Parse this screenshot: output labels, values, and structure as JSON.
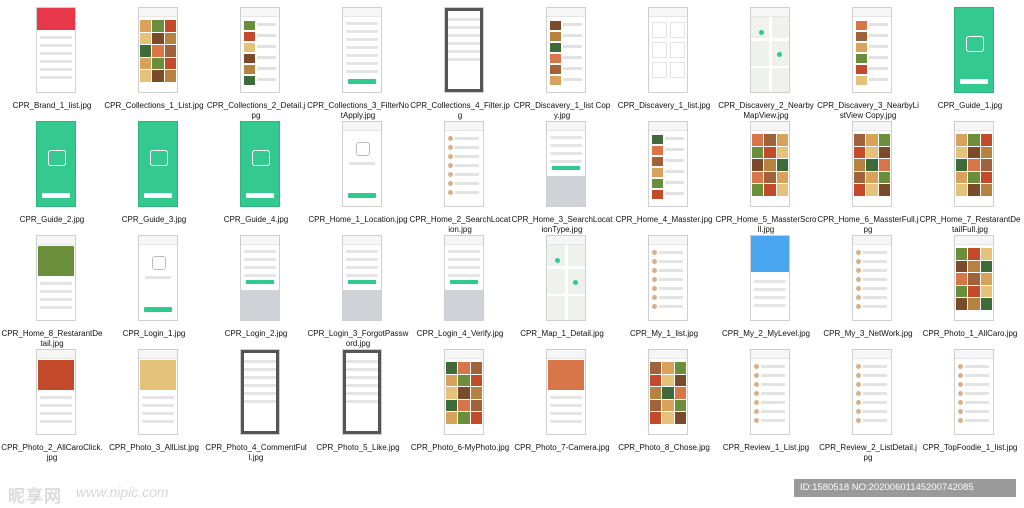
{
  "tiles": [
    {
      "label": "CPR_Brand_1_list.jpg",
      "style": "brand"
    },
    {
      "label": "CPR_Collections_1_List.jpg",
      "style": "photos"
    },
    {
      "label": "CPR_Collections_2_Detail.jpg",
      "style": "photolist"
    },
    {
      "label": "CPR_Collections_3_FilterNotApply.jpg",
      "style": "filter"
    },
    {
      "label": "CPR_Collections_4_Filter.jpg",
      "style": "dark"
    },
    {
      "label": "CPR_Discavery_1_list Copy.jpg",
      "style": "photolist"
    },
    {
      "label": "CPR_Discavery_1_list.jpg",
      "style": "cards"
    },
    {
      "label": "CPR_Discavery_2_NearbyMapView.jpg",
      "style": "map"
    },
    {
      "label": "CPR_Discavery_3_NearbyListView Copy.jpg",
      "style": "photolist"
    },
    {
      "label": "CPR_Guide_1.jpg",
      "style": "green"
    },
    {
      "label": "CPR_Guide_2.jpg",
      "style": "green"
    },
    {
      "label": "CPR_Guide_3.jpg",
      "style": "green"
    },
    {
      "label": "CPR_Guide_4.jpg",
      "style": "green"
    },
    {
      "label": "CPR_Home_1_Location.jpg",
      "style": "plain"
    },
    {
      "label": "CPR_Home_2_SearchLocation.jpg",
      "style": "list"
    },
    {
      "label": "CPR_Home_3_SearchLocationType.jpg",
      "style": "keyboard"
    },
    {
      "label": "CPR_Home_4_Masster.jpg",
      "style": "photolist"
    },
    {
      "label": "CPR_Home_5_MassterScroll.jpg",
      "style": "photos"
    },
    {
      "label": "CPR_Home_6_MassterFull.jpg",
      "style": "photos"
    },
    {
      "label": "CPR_Home_7_RestarantDetailFull.jpg",
      "style": "photos"
    },
    {
      "label": "CPR_Home_8_RestarantDetail.jpg",
      "style": "detail"
    },
    {
      "label": "CPR_Login_1.jpg",
      "style": "plain"
    },
    {
      "label": "CPR_Login_2.jpg",
      "style": "keyboard"
    },
    {
      "label": "CPR_Login_3_ForgotPassword.jpg",
      "style": "keyboard"
    },
    {
      "label": "CPR_Login_4_Verify.jpg",
      "style": "keyboard"
    },
    {
      "label": "CPR_Map_1_Detail.jpg",
      "style": "map"
    },
    {
      "label": "CPR_My_1_list.jpg",
      "style": "list"
    },
    {
      "label": "CPR_My_2_MyLevel.jpg",
      "style": "blue"
    },
    {
      "label": "CPR_My_3_NetWork.jpg",
      "style": "list"
    },
    {
      "label": "CPR_Photo_1_AllCaro.jpg",
      "style": "photos"
    },
    {
      "label": "CPR_Photo_2_AllCaroClick.jpg",
      "style": "detail"
    },
    {
      "label": "CPR_Photo_3_AllList.jpg",
      "style": "detail"
    },
    {
      "label": "CPR_Photo_4_CommentFull.jpg",
      "style": "dark"
    },
    {
      "label": "CPR_Photo_5_Like.jpg",
      "style": "dark"
    },
    {
      "label": "CPR_Photo_6-MyPhoto.jpg",
      "style": "photos"
    },
    {
      "label": "CPR_Photo_7-Camera.jpg",
      "style": "detail"
    },
    {
      "label": "CPR_Photo_8_Chose.jpg",
      "style": "photos"
    },
    {
      "label": "CPR_Review_1_List.jpg",
      "style": "list"
    },
    {
      "label": "CPR_Review_2_ListDetail.jpg",
      "style": "list"
    },
    {
      "label": "CPR_TopFoodie_1_list.jpg",
      "style": "list"
    }
  ],
  "watermark": {
    "logo": "昵享网",
    "url": "www.nipic.com"
  },
  "id_bar": {
    "text": "ID:1580518 NO:20200601145200742085"
  },
  "colors": {
    "accent_green": "#2fcb8e",
    "brand_red": "#e8364a",
    "blue": "#4aa6ee"
  }
}
